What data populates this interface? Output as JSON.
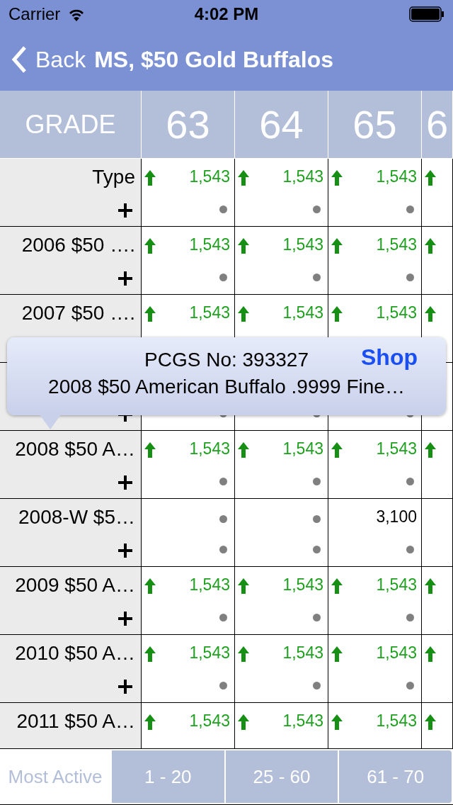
{
  "status_bar": {
    "carrier": "Carrier",
    "time": "4:02 PM"
  },
  "nav": {
    "back": "Back",
    "title": "MS, $50 Gold Buffalos"
  },
  "table": {
    "columns": [
      "GRADE",
      "63",
      "64",
      "65",
      "6"
    ],
    "rows": [
      {
        "label": "Type",
        "plus": true,
        "cells": [
          {
            "rising": true,
            "value": "1,543",
            "top_dot": false,
            "bottom_dot": true
          },
          {
            "rising": true,
            "value": "1,543",
            "top_dot": false,
            "bottom_dot": true
          },
          {
            "rising": true,
            "value": "1,543",
            "top_dot": false,
            "bottom_dot": true
          },
          {
            "rising": true,
            "top_dot": false,
            "bottom_dot": false
          }
        ]
      },
      {
        "label": "2006 $50 ….",
        "plus": true,
        "cells": [
          {
            "rising": true,
            "value": "1,543",
            "top_dot": false,
            "bottom_dot": true
          },
          {
            "rising": true,
            "value": "1,543",
            "top_dot": false,
            "bottom_dot": true
          },
          {
            "rising": true,
            "value": "1,543",
            "top_dot": false,
            "bottom_dot": true
          },
          {
            "rising": true,
            "top_dot": false,
            "bottom_dot": false
          }
        ]
      },
      {
        "label": "2007 $50 ….",
        "plus": false,
        "cells": [
          {
            "rising": true,
            "value": "1,543",
            "top_dot": false,
            "bottom_dot": false
          },
          {
            "rising": true,
            "value": "1,543",
            "top_dot": false,
            "bottom_dot": false
          },
          {
            "rising": true,
            "value": "1,543",
            "top_dot": false,
            "bottom_dot": false
          },
          {
            "rising": true,
            "top_dot": false,
            "bottom_dot": false
          }
        ]
      },
      {
        "plus": true,
        "cells": [
          {
            "rising": false,
            "top_dot": false,
            "bottom_dot": true
          },
          {
            "rising": false,
            "top_dot": false,
            "bottom_dot": true
          },
          {
            "rising": false,
            "top_dot": false,
            "bottom_dot": true
          },
          {
            "rising": false,
            "top_dot": false,
            "bottom_dot": false
          }
        ]
      },
      {
        "label": "2008 $50 A…",
        "plus": true,
        "cells": [
          {
            "rising": true,
            "value": "1,543",
            "top_dot": false,
            "bottom_dot": true
          },
          {
            "rising": true,
            "value": "1,543",
            "top_dot": false,
            "bottom_dot": true
          },
          {
            "rising": true,
            "value": "1,543",
            "top_dot": false,
            "bottom_dot": true
          },
          {
            "rising": true,
            "top_dot": false,
            "bottom_dot": false
          }
        ]
      },
      {
        "label": "2008-W $5…",
        "plus": true,
        "cells": [
          {
            "rising": false,
            "top_dot": true,
            "bottom_dot": true
          },
          {
            "rising": false,
            "top_dot": true,
            "bottom_dot": true
          },
          {
            "rising": false,
            "value": "3,100",
            "top_dot": false,
            "bottom_dot": true
          },
          {
            "rising": false,
            "top_dot": false,
            "bottom_dot": false
          }
        ]
      },
      {
        "label": "2009 $50 A…",
        "plus": true,
        "cells": [
          {
            "rising": true,
            "value": "1,543",
            "top_dot": false,
            "bottom_dot": true
          },
          {
            "rising": true,
            "value": "1,543",
            "top_dot": false,
            "bottom_dot": true
          },
          {
            "rising": true,
            "value": "1,543",
            "top_dot": false,
            "bottom_dot": true
          },
          {
            "rising": true,
            "top_dot": false,
            "bottom_dot": false
          }
        ]
      },
      {
        "label": "2010 $50 A…",
        "plus": true,
        "cells": [
          {
            "rising": true,
            "value": "1,543",
            "top_dot": false,
            "bottom_dot": true
          },
          {
            "rising": true,
            "value": "1,543",
            "top_dot": false,
            "bottom_dot": true
          },
          {
            "rising": true,
            "value": "1,543",
            "top_dot": false,
            "bottom_dot": true
          },
          {
            "rising": true,
            "top_dot": false,
            "bottom_dot": false
          }
        ]
      },
      {
        "label": "2011 $50 A…",
        "plus": false,
        "cells": [
          {
            "rising": true,
            "value": "1,543",
            "top_dot": false,
            "bottom_dot": false
          },
          {
            "rising": true,
            "value": "1,543",
            "top_dot": false,
            "bottom_dot": false
          },
          {
            "rising": true,
            "value": "1,543",
            "top_dot": false,
            "bottom_dot": false
          },
          {
            "rising": true,
            "top_dot": false,
            "bottom_dot": false
          }
        ]
      }
    ]
  },
  "popover": {
    "pcgs": "PCGS No: 393327",
    "shop": "Shop",
    "description": "2008 $50 American Buffalo .9999 Fine…"
  },
  "segments": [
    {
      "label": "Most Active",
      "selected": true
    },
    {
      "label": "1 - 20",
      "selected": false
    },
    {
      "label": "25 - 60",
      "selected": false
    },
    {
      "label": "61 - 70",
      "selected": false
    }
  ]
}
